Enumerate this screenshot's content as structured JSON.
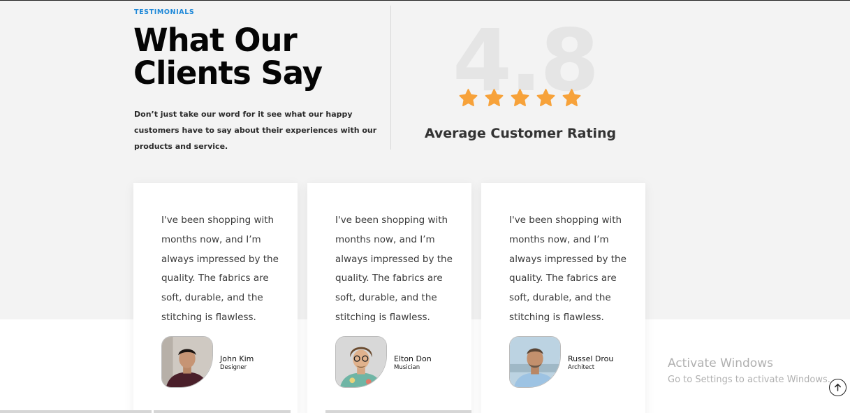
{
  "section": {
    "eyebrow": "TESTIMONIALS",
    "title_line1": "What Our",
    "title_line2": "Clients Say",
    "subtitle": "Don’t just take our word for it see what our happy customers have to say about their experiences with our products and service."
  },
  "rating": {
    "value": "4.8",
    "stars": 5,
    "star_color": "#f7a23a",
    "caption": "Average Customer Rating"
  },
  "testimonials": [
    {
      "quote": "I've been shopping with months now, and I’m always impressed by the quality. The fabrics are soft, durable, and the stitching is flawless.",
      "name": "John Kim",
      "role": "Designer"
    },
    {
      "quote": "I've been shopping with months now, and I’m always impressed by the quality. The fabrics are soft, durable, and the stitching is flawless.",
      "name": "Elton Don",
      "role": "Musician"
    },
    {
      "quote": "I've been shopping with months now, and I’m always impressed by the quality. The fabrics are soft, durable, and the stitching is flawless.",
      "name": "Russel Drou",
      "role": "Architect"
    }
  ],
  "watermark": {
    "title": "Activate Windows",
    "subtitle": "Go to Settings to activate Windows."
  },
  "colors": {
    "eyebrow": "#1e88d8",
    "section_bg": "#f3f3f3",
    "rating_number": "#e5e5e5"
  },
  "icons": {
    "star": "star-icon",
    "scroll_top": "arrow-up-icon"
  }
}
